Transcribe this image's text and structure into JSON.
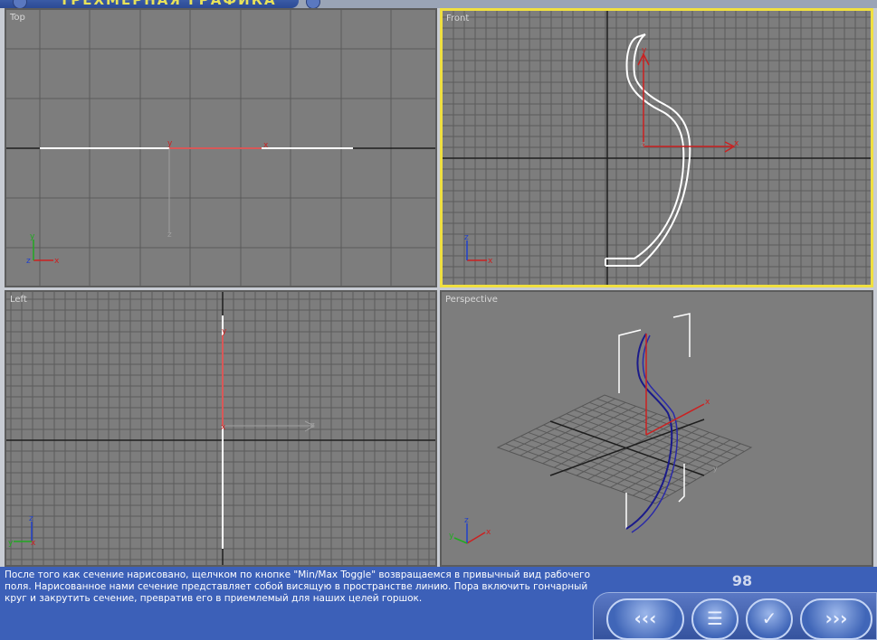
{
  "header": {
    "title": "ТРЕХМЕРНАЯ ГРАФИКА"
  },
  "viewports": {
    "top": {
      "label": "Top"
    },
    "front": {
      "label": "Front"
    },
    "left": {
      "label": "Left"
    },
    "perspective": {
      "label": "Perspective"
    }
  },
  "axes": {
    "x": "x",
    "y": "y",
    "z": "z"
  },
  "footer": {
    "description": "После того как сечение нарисовано, щелчком по кнопке \"Min/Max Toggle\" возвращаемся в привычный вид рабочего поля. Нарисованное нами сечение представляет собой висящую в пространстве линию. Пора включить гончарный круг и закрутить сечение, превратив его в приемлемый для наших целей горшок.",
    "page_number": "98"
  },
  "nav": {
    "back_icon": "double-chevron-left-icon",
    "menu_icon": "list-menu-icon",
    "check_icon": "checkmark-icon",
    "forward_icon": "double-chevron-right-icon"
  },
  "colors": {
    "active_viewport_border": "#f0e040",
    "viewport_bg": "#7d7d7d",
    "axis_x": "#cc2020",
    "axis_y": "#20aa20",
    "axis_z": "#2040cc",
    "spline_selected": "#ffffff",
    "spline_perspective": "#1a1a8a",
    "panel_blue": "#3c60b8"
  }
}
